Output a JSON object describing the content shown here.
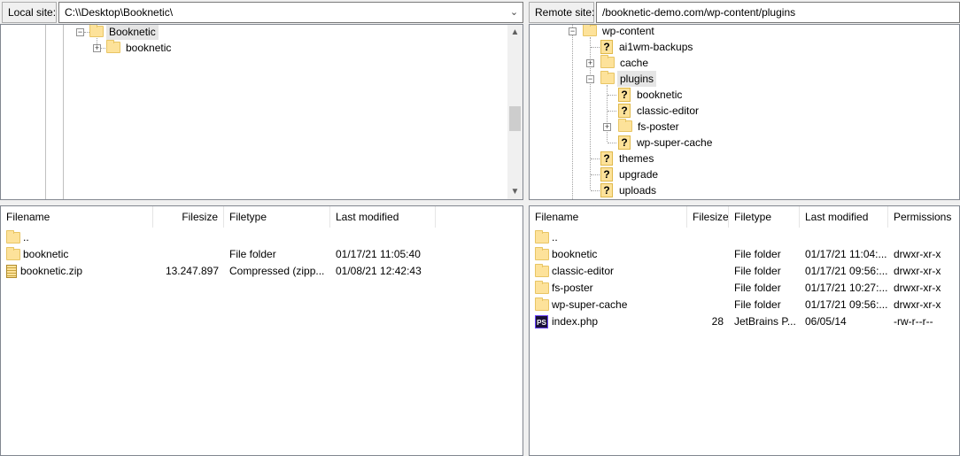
{
  "local": {
    "label": "Local site:",
    "path": "C:\\\\Desktop\\Booknetic\\",
    "tree": [
      {
        "label": "Booknetic",
        "expander": "minus",
        "selected": true
      },
      {
        "label": "booknetic",
        "expander": "plus",
        "selected": false
      }
    ],
    "columns": [
      "Filename",
      "Filesize",
      "Filetype",
      "Last modified"
    ],
    "files": [
      {
        "name": "..",
        "size": "",
        "type": "",
        "modified": "",
        "icon": "folder-icon"
      },
      {
        "name": "booknetic",
        "size": "",
        "type": "File folder",
        "modified": "01/17/21 11:05:40",
        "icon": "folder-icon"
      },
      {
        "name": "booknetic.zip",
        "size": "13.247.897",
        "type": "Compressed (zipp...",
        "modified": "01/08/21 12:42:43",
        "icon": "zip-file-icon"
      }
    ]
  },
  "remote": {
    "label": "Remote site:",
    "path": "/booknetic-demo.com/wp-content/plugins",
    "tree": {
      "root": "wp-content",
      "children": [
        {
          "label": "ai1wm-backups",
          "unknown": true
        },
        {
          "label": "cache",
          "unknown": false,
          "expander": "plus"
        },
        {
          "label": "plugins",
          "unknown": false,
          "expander": "minus",
          "selected": true
        },
        {
          "label": "booknetic",
          "unknown": true,
          "level": 2
        },
        {
          "label": "classic-editor",
          "unknown": true,
          "level": 2
        },
        {
          "label": "fs-poster",
          "unknown": false,
          "level": 2,
          "expander": "plus"
        },
        {
          "label": "wp-super-cache",
          "unknown": true,
          "level": 2
        },
        {
          "label": "themes",
          "unknown": true
        },
        {
          "label": "upgrade",
          "unknown": true
        },
        {
          "label": "uploads",
          "unknown": true
        }
      ]
    },
    "columns": [
      "Filename",
      "Filesize",
      "Filetype",
      "Last modified",
      "Permissions"
    ],
    "files": [
      {
        "name": "..",
        "size": "",
        "type": "",
        "modified": "",
        "perms": "",
        "icon": "folder-icon"
      },
      {
        "name": "booknetic",
        "size": "",
        "type": "File folder",
        "modified": "01/17/21 11:04:...",
        "perms": "drwxr-xr-x",
        "icon": "folder-icon"
      },
      {
        "name": "classic-editor",
        "size": "",
        "type": "File folder",
        "modified": "01/17/21 09:56:...",
        "perms": "drwxr-xr-x",
        "icon": "folder-icon"
      },
      {
        "name": "fs-poster",
        "size": "",
        "type": "File folder",
        "modified": "01/17/21 10:27:...",
        "perms": "drwxr-xr-x",
        "icon": "folder-icon"
      },
      {
        "name": "wp-super-cache",
        "size": "",
        "type": "File folder",
        "modified": "01/17/21 09:56:...",
        "perms": "drwxr-xr-x",
        "icon": "folder-icon"
      },
      {
        "name": "index.php",
        "size": "28",
        "type": "JetBrains P...",
        "modified": "06/05/14",
        "perms": "-rw-r--r--",
        "icon": "phpstorm-file-icon"
      }
    ]
  }
}
